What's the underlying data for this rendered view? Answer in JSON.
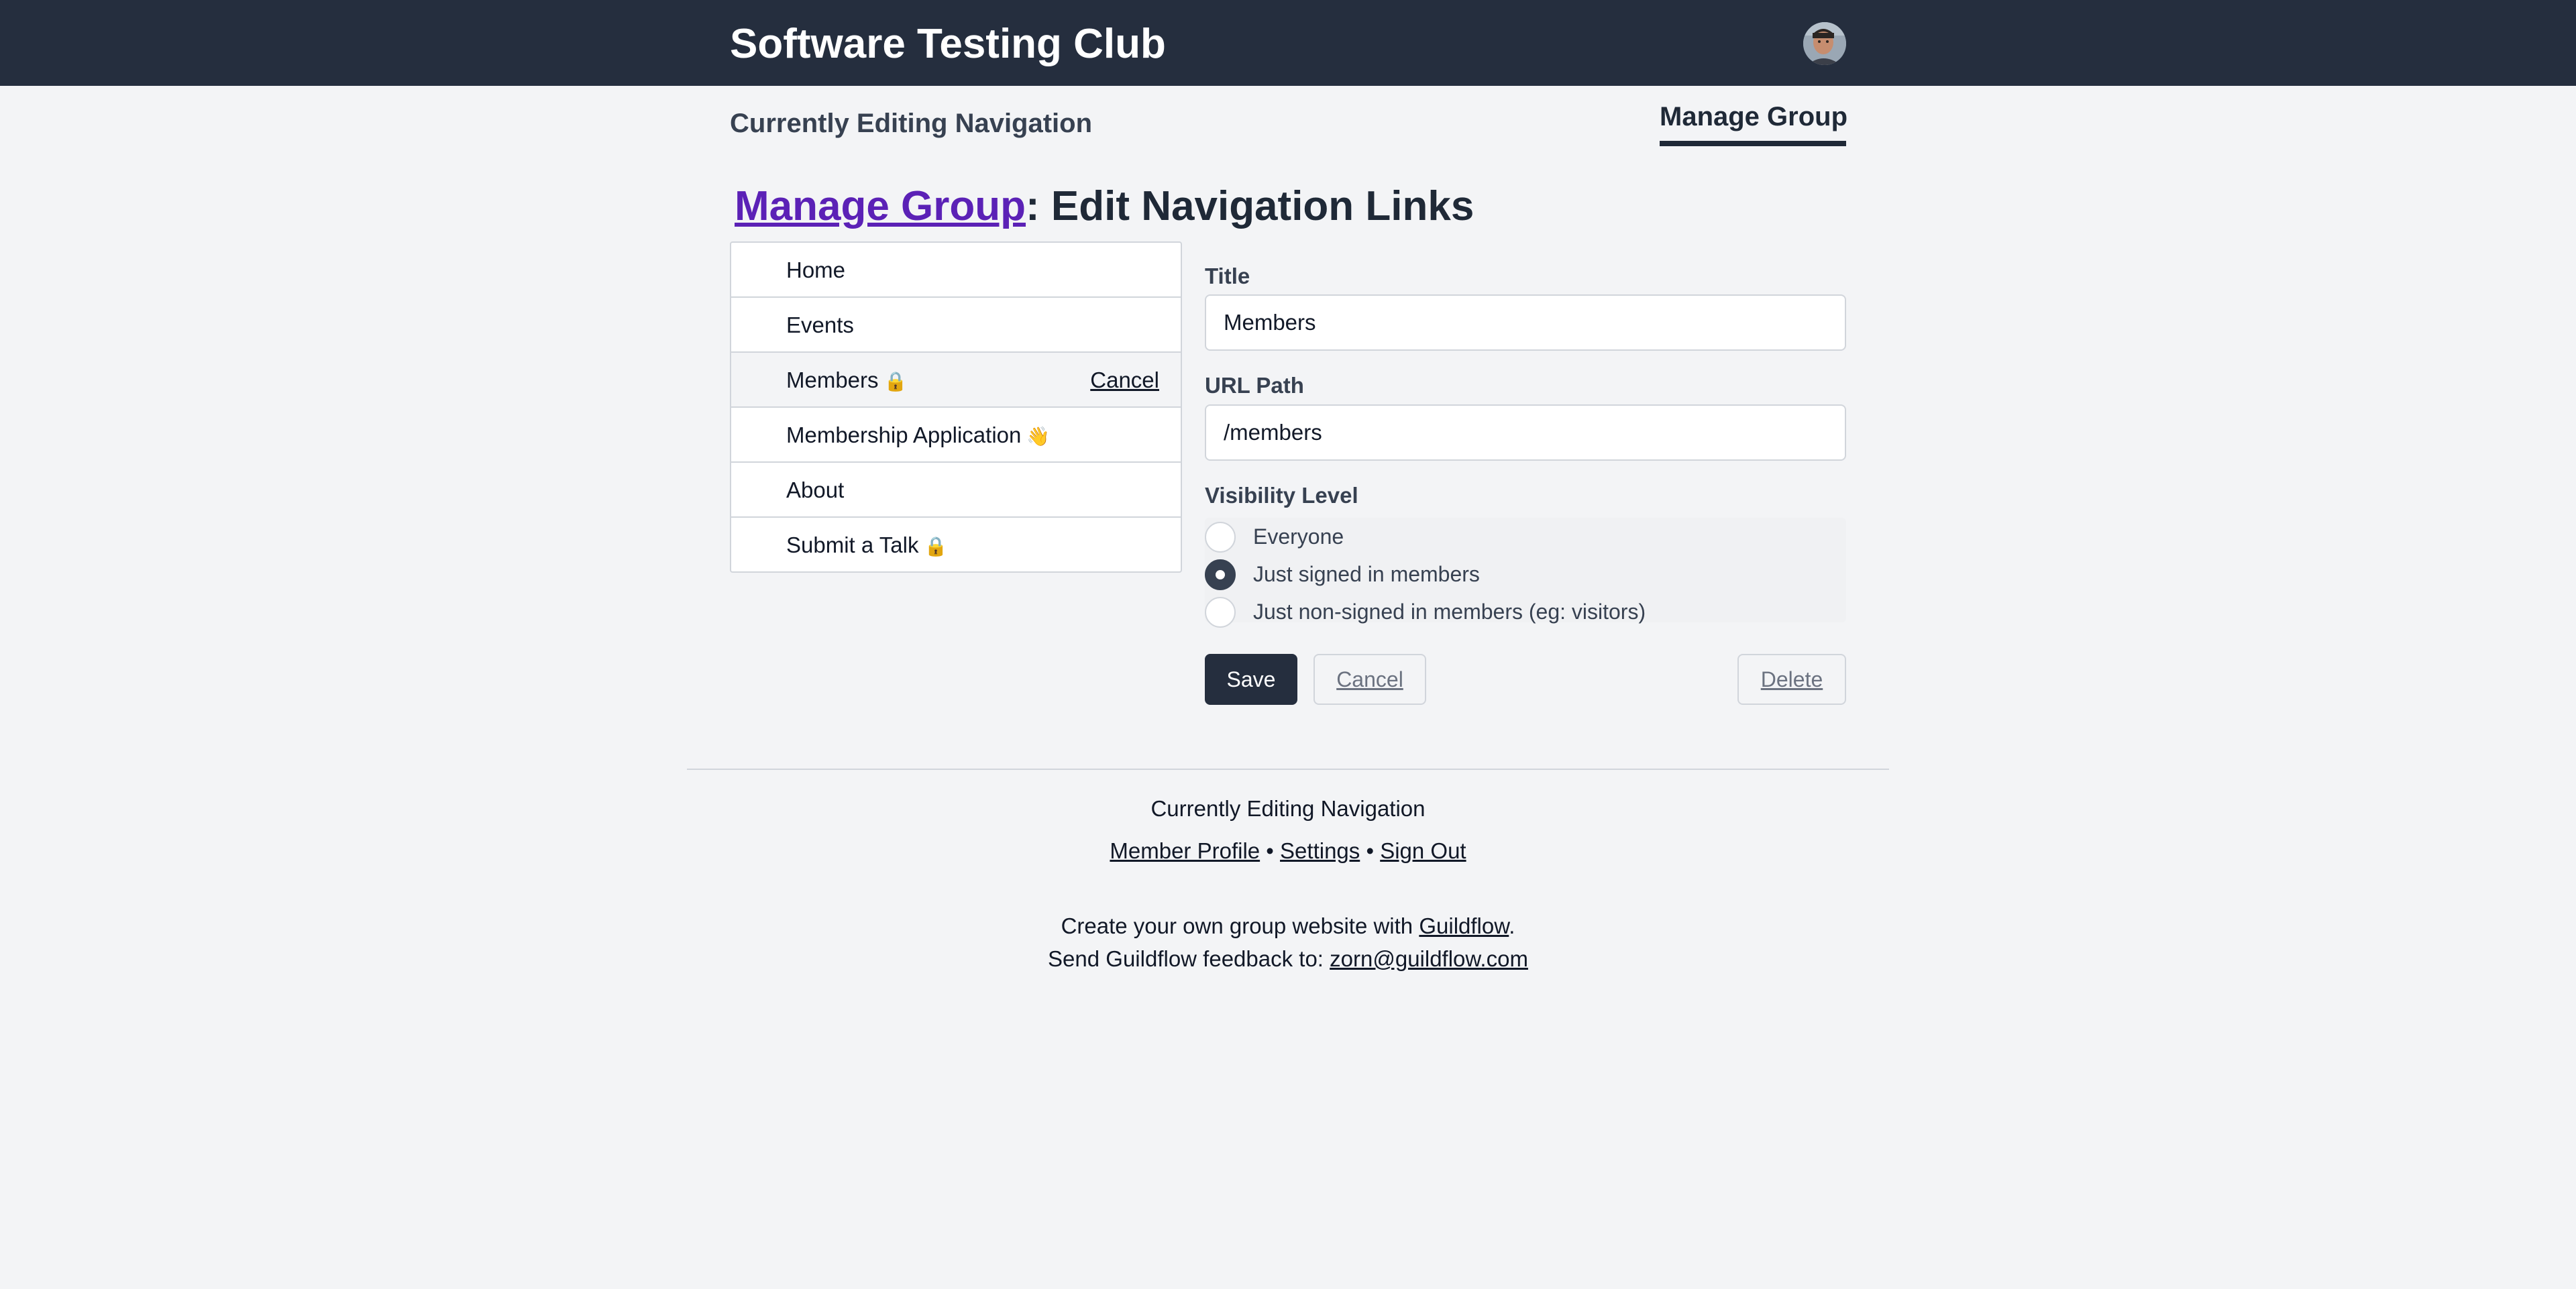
{
  "header": {
    "site_title": "Software Testing Club",
    "avatar_icon": "user-avatar"
  },
  "subnav": {
    "left_label": "Currently Editing Navigation",
    "right_tab": "Manage Group"
  },
  "heading": {
    "link_text": "Manage Group",
    "rest_text": ": Edit Navigation Links"
  },
  "nav_items": [
    {
      "label": "Home",
      "emoji": ""
    },
    {
      "label": "Events",
      "emoji": ""
    },
    {
      "label": "Members",
      "emoji": "🔒",
      "selected": true,
      "cancel_label": "Cancel"
    },
    {
      "label": "Membership Application",
      "emoji": "👋"
    },
    {
      "label": "About",
      "emoji": ""
    },
    {
      "label": "Submit a Talk",
      "emoji": "🔒"
    }
  ],
  "form": {
    "title_label": "Title",
    "title_value": "Members",
    "url_label": "URL Path",
    "url_value": "/members",
    "visibility_label": "Visibility Level",
    "visibility_options": [
      {
        "label": "Everyone",
        "checked": false
      },
      {
        "label": "Just signed in members",
        "checked": true
      },
      {
        "label": "Just non-signed in members (eg: visitors)",
        "checked": false
      }
    ],
    "save_label": "Save",
    "cancel_label": "Cancel",
    "delete_label": "Delete"
  },
  "footer": {
    "editing_text": "Currently Editing Navigation",
    "links": [
      "Member Profile",
      "Settings",
      "Sign Out"
    ],
    "separator": "•",
    "create_prefix": "Create your own group website with ",
    "create_link": "Guildflow",
    "create_suffix": ".",
    "feedback_prefix": "Send Guildflow feedback to: ",
    "feedback_email": "zorn@guildflow.com"
  },
  "colors": {
    "header_bg": "#252e3e",
    "page_bg": "#f3f4f6",
    "heading_link": "#5b21b6"
  }
}
